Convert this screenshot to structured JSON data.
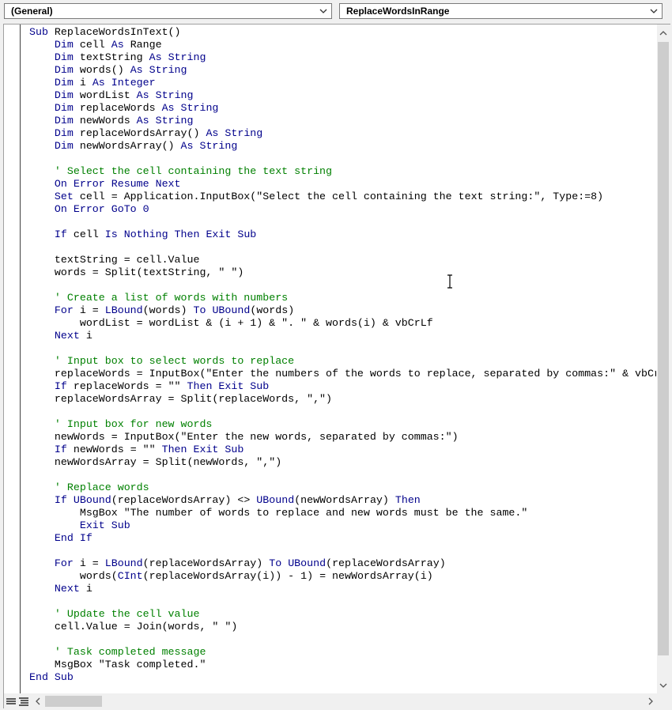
{
  "header": {
    "object_combo": "(General)",
    "procedure_combo": "ReplaceWordsInRange"
  },
  "code_lines": [
    [
      {
        "t": "Sub ",
        "c": "kw"
      },
      {
        "t": "ReplaceWordsInText()"
      }
    ],
    [
      {
        "t": "    "
      },
      {
        "t": "Dim ",
        "c": "kw"
      },
      {
        "t": "cell "
      },
      {
        "t": "As ",
        "c": "kw"
      },
      {
        "t": "Range"
      }
    ],
    [
      {
        "t": "    "
      },
      {
        "t": "Dim ",
        "c": "kw"
      },
      {
        "t": "textString "
      },
      {
        "t": "As ",
        "c": "kw"
      },
      {
        "t": "String",
        "c": "kw"
      }
    ],
    [
      {
        "t": "    "
      },
      {
        "t": "Dim ",
        "c": "kw"
      },
      {
        "t": "words() "
      },
      {
        "t": "As ",
        "c": "kw"
      },
      {
        "t": "String",
        "c": "kw"
      }
    ],
    [
      {
        "t": "    "
      },
      {
        "t": "Dim ",
        "c": "kw"
      },
      {
        "t": "i "
      },
      {
        "t": "As ",
        "c": "kw"
      },
      {
        "t": "Integer",
        "c": "kw"
      }
    ],
    [
      {
        "t": "    "
      },
      {
        "t": "Dim ",
        "c": "kw"
      },
      {
        "t": "wordList "
      },
      {
        "t": "As ",
        "c": "kw"
      },
      {
        "t": "String",
        "c": "kw"
      }
    ],
    [
      {
        "t": "    "
      },
      {
        "t": "Dim ",
        "c": "kw"
      },
      {
        "t": "replaceWords "
      },
      {
        "t": "As ",
        "c": "kw"
      },
      {
        "t": "String",
        "c": "kw"
      }
    ],
    [
      {
        "t": "    "
      },
      {
        "t": "Dim ",
        "c": "kw"
      },
      {
        "t": "newWords "
      },
      {
        "t": "As ",
        "c": "kw"
      },
      {
        "t": "String",
        "c": "kw"
      }
    ],
    [
      {
        "t": "    "
      },
      {
        "t": "Dim ",
        "c": "kw"
      },
      {
        "t": "replaceWordsArray() "
      },
      {
        "t": "As ",
        "c": "kw"
      },
      {
        "t": "String",
        "c": "kw"
      }
    ],
    [
      {
        "t": "    "
      },
      {
        "t": "Dim ",
        "c": "kw"
      },
      {
        "t": "newWordsArray() "
      },
      {
        "t": "As ",
        "c": "kw"
      },
      {
        "t": "String",
        "c": "kw"
      }
    ],
    [],
    [
      {
        "t": "    ' Select the cell containing the text string",
        "c": "cm"
      }
    ],
    [
      {
        "t": "    "
      },
      {
        "t": "On Error Resume Next",
        "c": "kw"
      }
    ],
    [
      {
        "t": "    "
      },
      {
        "t": "Set ",
        "c": "kw"
      },
      {
        "t": "cell = Application.InputBox(\"Select the cell containing the text string:\", Type:=8)"
      }
    ],
    [
      {
        "t": "    "
      },
      {
        "t": "On Error GoTo ",
        "c": "kw"
      },
      {
        "t": "0",
        "c": "kw"
      }
    ],
    [],
    [
      {
        "t": "    "
      },
      {
        "t": "If ",
        "c": "kw"
      },
      {
        "t": "cell "
      },
      {
        "t": "Is Nothing Then Exit Sub",
        "c": "kw"
      }
    ],
    [],
    [
      {
        "t": "    textString = cell.Value"
      }
    ],
    [
      {
        "t": "    words = Split(textString, \" \")"
      }
    ],
    [],
    [
      {
        "t": "    ' Create a list of words with numbers",
        "c": "cm"
      }
    ],
    [
      {
        "t": "    "
      },
      {
        "t": "For ",
        "c": "kw"
      },
      {
        "t": "i = "
      },
      {
        "t": "LBound",
        "c": "kw"
      },
      {
        "t": "(words) "
      },
      {
        "t": "To ",
        "c": "kw"
      },
      {
        "t": "UBound",
        "c": "kw"
      },
      {
        "t": "(words)"
      }
    ],
    [
      {
        "t": "        wordList = wordList & (i + 1) & \". \" & words(i) & vbCrLf"
      }
    ],
    [
      {
        "t": "    "
      },
      {
        "t": "Next ",
        "c": "kw"
      },
      {
        "t": "i"
      }
    ],
    [],
    [
      {
        "t": "    ' Input box to select words to replace",
        "c": "cm"
      }
    ],
    [
      {
        "t": "    replaceWords = InputBox(\"Enter the numbers of the words to replace, separated by commas:\" & vbCrLf"
      }
    ],
    [
      {
        "t": "    "
      },
      {
        "t": "If ",
        "c": "kw"
      },
      {
        "t": "replaceWords = \"\" "
      },
      {
        "t": "Then Exit Sub",
        "c": "kw"
      }
    ],
    [
      {
        "t": "    replaceWordsArray = Split(replaceWords, \",\")"
      }
    ],
    [],
    [
      {
        "t": "    ' Input box for new words",
        "c": "cm"
      }
    ],
    [
      {
        "t": "    newWords = InputBox(\"Enter the new words, separated by commas:\")"
      }
    ],
    [
      {
        "t": "    "
      },
      {
        "t": "If ",
        "c": "kw"
      },
      {
        "t": "newWords = \"\" "
      },
      {
        "t": "Then Exit Sub",
        "c": "kw"
      }
    ],
    [
      {
        "t": "    newWordsArray = Split(newWords, \",\")"
      }
    ],
    [],
    [
      {
        "t": "    ' Replace words",
        "c": "cm"
      }
    ],
    [
      {
        "t": "    "
      },
      {
        "t": "If ",
        "c": "kw"
      },
      {
        "t": "UBound",
        "c": "kw"
      },
      {
        "t": "(replaceWordsArray) <> "
      },
      {
        "t": "UBound",
        "c": "kw"
      },
      {
        "t": "(newWordsArray) "
      },
      {
        "t": "Then",
        "c": "kw"
      }
    ],
    [
      {
        "t": "        MsgBox \"The number of words to replace and new words must be the same.\""
      }
    ],
    [
      {
        "t": "        "
      },
      {
        "t": "Exit Sub",
        "c": "kw"
      }
    ],
    [
      {
        "t": "    "
      },
      {
        "t": "End If",
        "c": "kw"
      }
    ],
    [],
    [
      {
        "t": "    "
      },
      {
        "t": "For ",
        "c": "kw"
      },
      {
        "t": "i = "
      },
      {
        "t": "LBound",
        "c": "kw"
      },
      {
        "t": "(replaceWordsArray) "
      },
      {
        "t": "To ",
        "c": "kw"
      },
      {
        "t": "UBound",
        "c": "kw"
      },
      {
        "t": "(replaceWordsArray)"
      }
    ],
    [
      {
        "t": "        words("
      },
      {
        "t": "CInt",
        "c": "kw"
      },
      {
        "t": "(replaceWordsArray(i)) - 1) = newWordsArray(i)"
      }
    ],
    [
      {
        "t": "    "
      },
      {
        "t": "Next ",
        "c": "kw"
      },
      {
        "t": "i"
      }
    ],
    [],
    [
      {
        "t": "    ' Update the cell value",
        "c": "cm"
      }
    ],
    [
      {
        "t": "    cell.Value = Join(words, \" \")"
      }
    ],
    [],
    [
      {
        "t": "    ' Task completed message",
        "c": "cm"
      }
    ],
    [
      {
        "t": "    MsgBox \"Task completed.\""
      }
    ],
    [
      {
        "t": "End Sub",
        "c": "kw"
      }
    ]
  ],
  "icons": {
    "combo_arrow": "chevron-down-icon",
    "scroll_up": "arrow-up-icon",
    "scroll_down": "arrow-down-icon",
    "scroll_left": "arrow-left-icon",
    "scroll_right": "arrow-right-icon",
    "procedure_view": "procedure-view-icon",
    "full_module_view": "full-module-view-icon",
    "text_cursor": "ibeam-cursor-icon"
  },
  "colors": {
    "keyword": "#00008b",
    "comment": "#008000",
    "text": "#000000"
  }
}
